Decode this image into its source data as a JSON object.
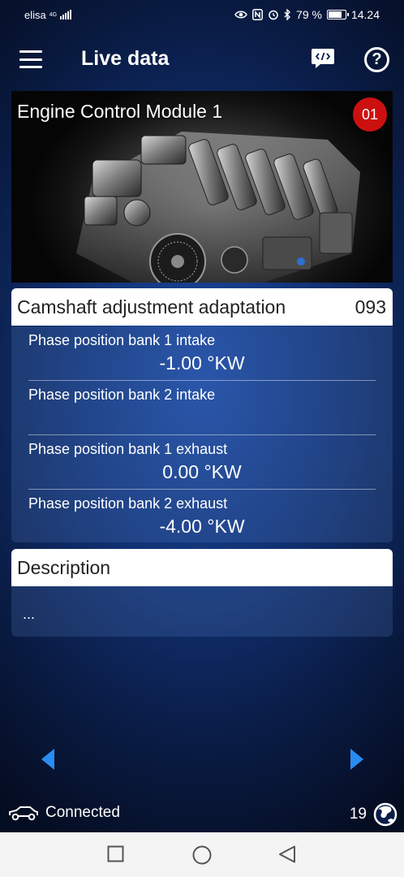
{
  "status_bar": {
    "carrier": "elisa",
    "network": "4G",
    "battery_percent": "79 %",
    "time": "14.24"
  },
  "app_bar": {
    "title": "Live data"
  },
  "module": {
    "title": "Engine Control Module 1",
    "badge": "01"
  },
  "group": {
    "title": "Camshaft adjustment adaptation",
    "number": "093",
    "parameters": [
      {
        "label": "Phase position bank 1 intake",
        "value": "-1.00 °KW"
      },
      {
        "label": "Phase position bank 2 intake",
        "value": ""
      },
      {
        "label": "Phase position bank 1 exhaust",
        "value": "0.00 °KW"
      },
      {
        "label": "Phase position bank 2 exhaust",
        "value": "-4.00 °KW"
      }
    ]
  },
  "description": {
    "title": "Description",
    "text": "..."
  },
  "footer": {
    "connection_status": "Connected",
    "count": "19"
  },
  "colors": {
    "accent_blue": "#2a8cf0",
    "badge_red": "#cc1010"
  }
}
